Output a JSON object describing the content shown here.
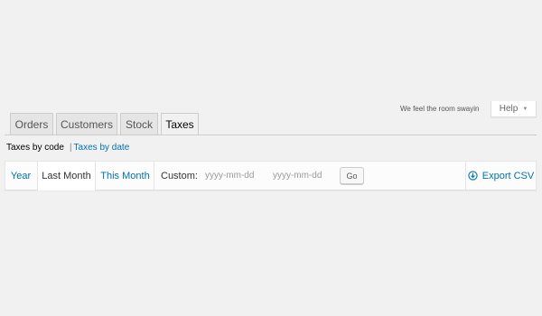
{
  "header": {
    "quote": "We feel the room swayin",
    "help_label": "Help",
    "help_caret": "▼"
  },
  "tabs": [
    {
      "label": "Orders",
      "active": false
    },
    {
      "label": "Customers",
      "active": false
    },
    {
      "label": "Stock",
      "active": false
    },
    {
      "label": "Taxes",
      "active": true
    }
  ],
  "subnav": {
    "current": "Taxes by code",
    "separator": "|",
    "link": "Taxes by date"
  },
  "ranges": {
    "year": "Year",
    "last_month": "Last Month",
    "this_month": "This Month",
    "selected": "Last Month"
  },
  "custom": {
    "label": "Custom:",
    "start_placeholder": "yyyy-mm-dd",
    "end_placeholder": "yyyy-mm-dd",
    "go_label": "Go"
  },
  "export": {
    "label": "Export CSV",
    "icon": "download-icon"
  },
  "colors": {
    "link": "#0073aa",
    "background": "#f1f1f1"
  }
}
